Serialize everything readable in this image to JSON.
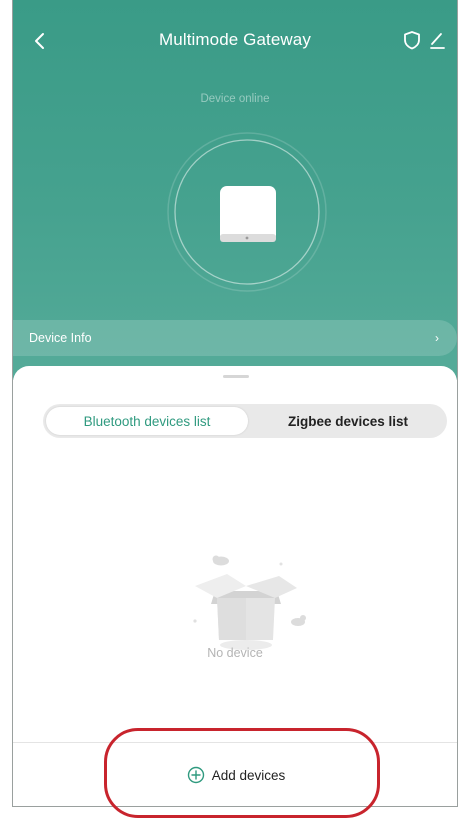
{
  "header": {
    "title": "Multimode Gateway",
    "back_icon": "chevron-left-icon",
    "shield_icon": "shield-icon",
    "edit_icon": "edit-icon"
  },
  "status_text": "Device online",
  "device_info": {
    "label": "Device Info",
    "chevron": "›"
  },
  "tabs": [
    {
      "label": "Bluetooth devices list",
      "active": true
    },
    {
      "label": "Zigbee devices list",
      "active": false
    }
  ],
  "empty_state": {
    "text": "No device",
    "icon": "empty-box-icon"
  },
  "add_button": {
    "label": "Add devices",
    "icon": "plus-circle-icon"
  },
  "colors": {
    "accent": "#2f9a7f",
    "header_bg": "#3a9b87",
    "highlight": "#c8242d"
  }
}
